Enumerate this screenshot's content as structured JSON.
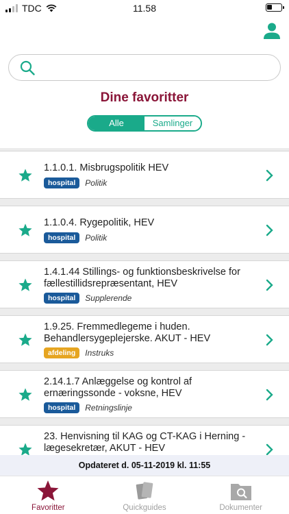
{
  "status_bar": {
    "carrier": "TDC",
    "time": "11.58",
    "battery_level": 0.35
  },
  "search": {
    "placeholder": ""
  },
  "page_title": "Dine favoritter",
  "segment": {
    "options": [
      "Alle",
      "Samlinger"
    ],
    "selected": "Alle"
  },
  "favorites": [
    {
      "title": "1.1.0.1. Misbrugspolitik HEV",
      "tag": "hospital",
      "category": "Politik"
    },
    {
      "title": "1.1.0.4. Rygepolitik, HEV",
      "tag": "hospital",
      "category": "Politik"
    },
    {
      "title": "1.4.1.44 Stillings- og funktionsbeskrivelse for fællestillidsrepræsentant, HEV",
      "tag": "hospital",
      "category": "Supplerende"
    },
    {
      "title": "1.9.25. Fremmedlegeme i huden. Behandlersygeplejerske. AKUT - HEV",
      "tag": "afdeling",
      "category": "Instruks"
    },
    {
      "title": "2.14.1.7 Anlæggelse og kontrol af ernæringssonde - voksne, HEV",
      "tag": "hospital",
      "category": "Retningslinje"
    },
    {
      "title": "23. Henvisning til KAG og CT-KAG i Herning - lægesekretær, AKUT - HEV",
      "tag": "",
      "category": ""
    }
  ],
  "updated_text": "Opdateret d. 05-11-2019 kl. 11:55",
  "tabs": [
    {
      "label": "Favoritter",
      "icon": "star-icon",
      "active": true
    },
    {
      "label": "Quickguides",
      "icon": "quickguides-icon",
      "active": false
    },
    {
      "label": "Dokumenter",
      "icon": "documents-icon",
      "active": false
    }
  ],
  "colors": {
    "accent": "#1aaa8a",
    "title": "#8a1538",
    "hospital_tag": "#1a5a9a",
    "afdeling_tag": "#e6a521"
  }
}
